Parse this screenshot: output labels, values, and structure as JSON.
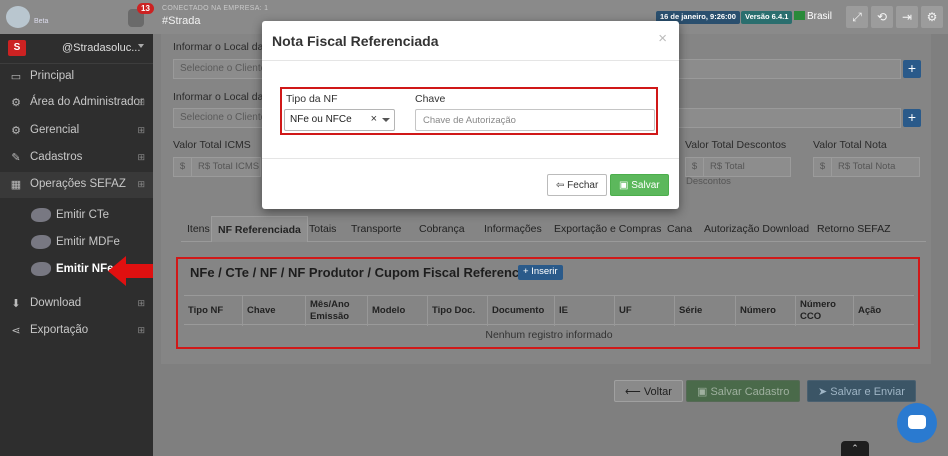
{
  "topbar": {
    "logo_text": "Beta",
    "notification_count": "13",
    "company_label": "CONECTADO NA EMPRESA: 1",
    "company_name": "#Strada",
    "date_badge": "16 de janeiro, 9:26:00",
    "version_badge": "Versão 6.4.1",
    "country": "Brasil",
    "icons": [
      "expand-icon",
      "refresh-icon",
      "logout-icon",
      "gear-icon"
    ]
  },
  "sidebar": {
    "user_name": "@Stradasoluc...",
    "items": [
      {
        "label": "Principal",
        "icon": "monitor-icon"
      },
      {
        "label": "Área do Administrador",
        "icon": "cogs-icon"
      },
      {
        "label": "Gerencial",
        "icon": "cogs-icon"
      },
      {
        "label": "Cadastros",
        "icon": "edit-icon"
      },
      {
        "label": "Operações SEFAZ",
        "icon": "windows-icon"
      },
      {
        "label": "Download",
        "icon": "download-icon"
      },
      {
        "label": "Exportação",
        "icon": "share-icon"
      }
    ],
    "subitems": [
      {
        "label": "Emitir CTe",
        "tag": "CTe"
      },
      {
        "label": "Emitir MDFe",
        "tag": "MDFe"
      },
      {
        "label": "Emitir NFe",
        "tag": "NFe"
      }
    ],
    "expand_symbol": "⊞"
  },
  "form": {
    "local1_label": "Informar o Local da R",
    "local1_placeholder": "Selecione o Cliente",
    "local2_label": "Informar o Local da E",
    "local2_placeholder": "Selecione o Cliente",
    "icms_label": "Valor Total ICMS",
    "icms_placeholder": "R$ Total ICMS",
    "descontos_label": "Valor Total Descontos",
    "descontos_placeholder": "R$ Total Descontos",
    "nota_label": "Valor Total Nota",
    "nota_placeholder": "R$ Total Nota",
    "currency": "$"
  },
  "tabs": [
    "Itens",
    "NF Referenciada",
    "Totais",
    "Transporte",
    "Cobrança",
    "Informações",
    "Exportação e Compras",
    "Cana",
    "Autorização Download",
    "Retorno SEFAZ"
  ],
  "ref": {
    "title": "NFe / CTe / NF / NF Produtor / Cupom Fiscal Referenciado",
    "insert_label": "+ Inserir",
    "columns": [
      "Tipo NF",
      "Chave",
      "Mês/Ano Emissão",
      "Modelo",
      "Tipo Doc.",
      "Documento",
      "IE",
      "UF",
      "Série",
      "Número",
      "Número CCO",
      "Ação"
    ],
    "empty_text": "Nenhum registro informado"
  },
  "actions": {
    "voltar": "Voltar",
    "salvar_cadastro": "Salvar Cadastro",
    "salvar_enviar": "Salvar e Enviar"
  },
  "modal": {
    "title": "Nota Fiscal Referenciada",
    "close": "×",
    "tipo_label": "Tipo da NF",
    "tipo_value": "NFe ou NFCe",
    "tipo_clear": "×",
    "chave_label": "Chave",
    "chave_placeholder": "Chave de Autorização",
    "fechar_label": "Fechar",
    "salvar_label": "Salvar"
  },
  "colors": {
    "highlight_red": "#d01818",
    "primary_blue": "#2a5a8a",
    "success_green": "#5cb85c",
    "chat_blue": "#2a7ad0"
  }
}
